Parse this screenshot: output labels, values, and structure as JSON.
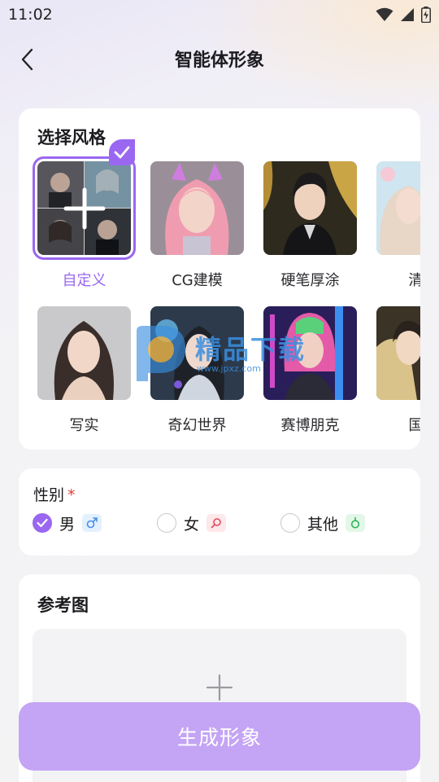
{
  "status_bar": {
    "time": "11:02"
  },
  "header": {
    "title": "智能体形象"
  },
  "style_section": {
    "title": "选择风格",
    "items": [
      {
        "label": "自定义",
        "selected": true
      },
      {
        "label": "CG建模"
      },
      {
        "label": "硬笔厚涂"
      },
      {
        "label": "清新"
      },
      {
        "label": "写实"
      },
      {
        "label": "奇幻世界"
      },
      {
        "label": "赛博朋克"
      },
      {
        "label": "国风"
      }
    ]
  },
  "gender": {
    "title": "性别",
    "required_mark": "*",
    "options": [
      {
        "label": "男",
        "icon": "male-icon",
        "checked": true,
        "tag_color": "#4a8fe8",
        "tag_bg": "#e3f0fd"
      },
      {
        "label": "女",
        "icon": "female-icon",
        "checked": false,
        "tag_color": "#e34a5a",
        "tag_bg": "#fde8ea"
      },
      {
        "label": "其他",
        "icon": "other-gender-icon",
        "checked": false,
        "tag_color": "#2fb55a",
        "tag_bg": "#e3f7e8"
      }
    ]
  },
  "reference": {
    "title": "参考图"
  },
  "generate_button": {
    "label": "生成形象"
  },
  "watermark": {
    "text": "精品下载",
    "sub": "www.jpxz.com"
  },
  "colors": {
    "accent": "#9a67f0",
    "button": "#c4a4f4"
  }
}
